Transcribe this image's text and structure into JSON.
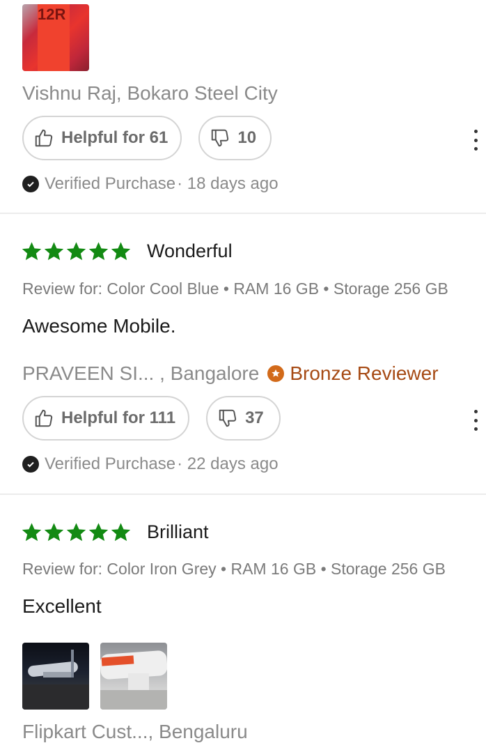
{
  "colors": {
    "star": "#138a13",
    "badge": "#a64a14",
    "muted": "#8a8a8a"
  },
  "reviews": [
    {
      "reviewer": "Vishnu Raj, Bokaro Steel City",
      "helpful_label": "Helpful for 61",
      "unhelpful_count": "10",
      "verified": "Verified Purchase",
      "age": "· 18 days ago",
      "thumb_text": "12R"
    },
    {
      "rating": 5,
      "title": "Wonderful",
      "variant": "Review for: Color Cool Blue • RAM 16 GB • Storage 256 GB",
      "body": "Awesome Mobile.",
      "reviewer": "PRAVEEN SI... , Bangalore",
      "badge": "Bronze Reviewer",
      "helpful_label": "Helpful for 111",
      "unhelpful_count": "37",
      "verified": "Verified Purchase",
      "age": "· 22 days ago"
    },
    {
      "rating": 5,
      "title": "Brilliant",
      "variant": "Review for: Color Iron Grey • RAM 16 GB • Storage 256 GB",
      "body": "Excellent",
      "reviewer": "Flipkart Cust..., Bengaluru"
    }
  ]
}
